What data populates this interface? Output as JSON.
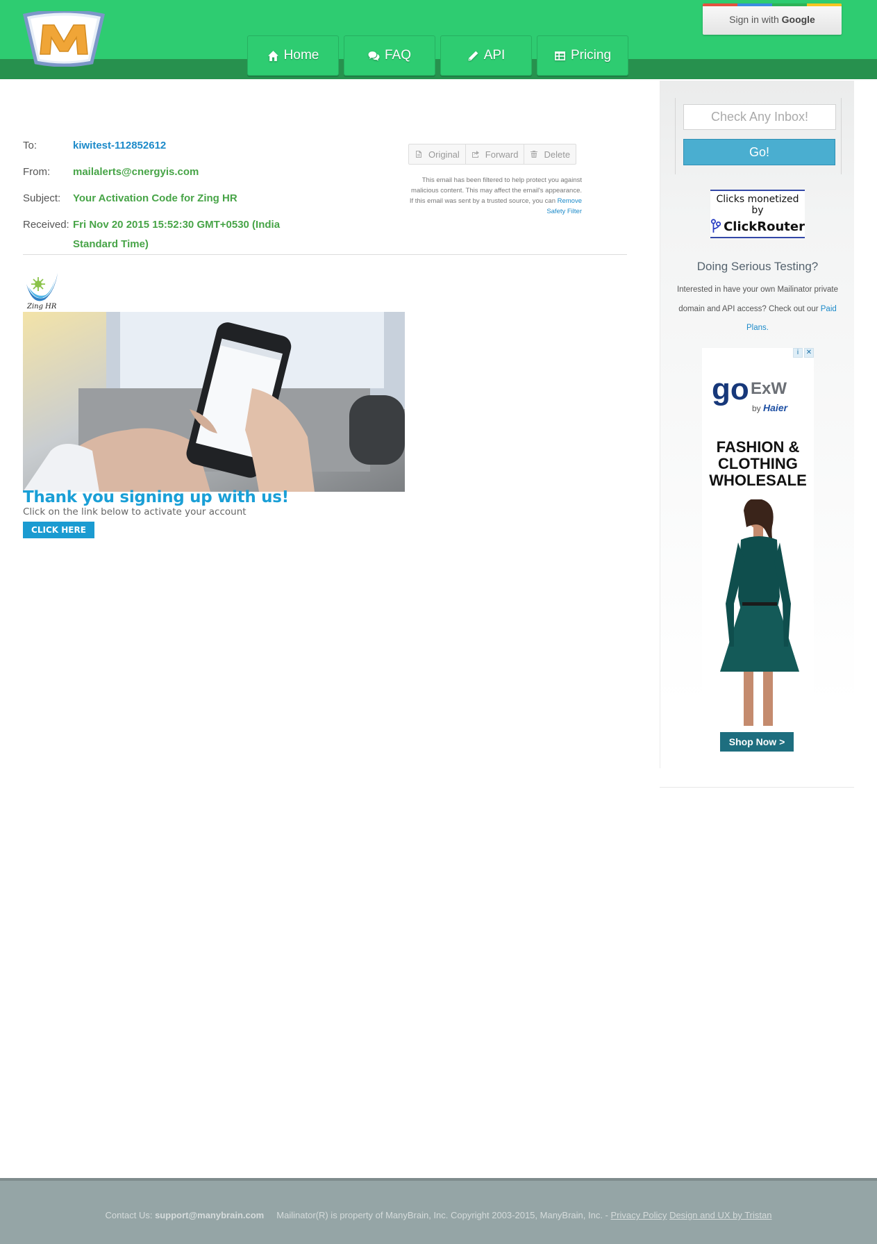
{
  "header": {
    "nav": [
      {
        "label": "Home",
        "icon": "home-icon"
      },
      {
        "label": "FAQ",
        "icon": "comments-icon"
      },
      {
        "label": "API",
        "icon": "pencil-icon"
      },
      {
        "label": "Pricing",
        "icon": "table-icon"
      }
    ],
    "google": {
      "prefix": "Sign in with ",
      "brand": "Google"
    },
    "colors": {
      "primary": "#2ecc71",
      "dark": "#27914e"
    }
  },
  "email": {
    "to_label": "To:",
    "to": "kiwitest-112852612",
    "from_label": "From:",
    "from": "mailalerts@cnergyis.com",
    "subject_label": "Subject:",
    "subject": "Your Activation Code for Zing HR",
    "received_label": "Received:",
    "received": "Fri Nov 20 2015 15:52:30 GMT+0530 (India Standard Time)",
    "actions": [
      {
        "label": "Original",
        "icon": "file-icon"
      },
      {
        "label": "Forward",
        "icon": "share-icon"
      },
      {
        "label": "Delete",
        "icon": "trash-icon"
      }
    ],
    "safety_text": "This email has been filtered to help protect you against malicious content. This may affect the email's appearance. If this email was sent by a trusted source, you can",
    "safety_link": "Remove Safety Filter",
    "body": {
      "logo_text": "Zing HR",
      "headline": "Thank you signing up with us!",
      "subline": "Click on the link below to activate your account",
      "cta": "CLICK HERE"
    }
  },
  "sidebar": {
    "inbox_placeholder": "Check Any Inbox!",
    "go_label": "Go!",
    "clickrouter_line1": "Clicks monetized by",
    "clickrouter_brand": "ClickRouter",
    "serious_title": "Doing Serious Testing?",
    "serious_text": "Interested in have your own Mailinator private domain and API access? Check out our",
    "serious_link": "Paid Plans.",
    "ad": {
      "brand_go": "go",
      "brand_exw": "ExW",
      "by": "by",
      "haier": "Haier",
      "title": "FASHION & CLOTHING WHOLESALE",
      "cta": "Shop Now >",
      "info": "i",
      "close": "✕"
    }
  },
  "footer": {
    "contact_label": "Contact Us:",
    "contact_email": "support@manybrain.com",
    "copyright": "Mailinator(R) is property of ManyBrain, Inc. Copyright 2003-2015, ManyBrain, Inc. -",
    "privacy": "Privacy Policy",
    "design": "Design and UX by Tristan"
  }
}
